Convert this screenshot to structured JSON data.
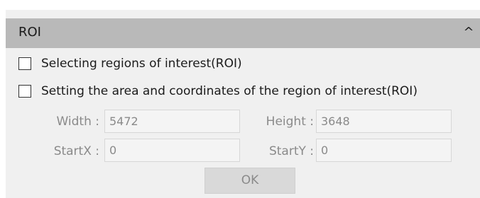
{
  "panel": {
    "title": "ROI",
    "collapse_icon": "chevron-up-icon",
    "collapse_glyph": "^"
  },
  "options": [
    {
      "label": "Selecting regions of interest(ROI)",
      "checked": false
    },
    {
      "label": "Setting the area and coordinates of the region of interest(ROI)",
      "checked": false
    }
  ],
  "fields": {
    "width": {
      "label": "Width :",
      "value": "5472"
    },
    "height": {
      "label": "Height :",
      "value": "3648"
    },
    "start_x": {
      "label": "StartX :",
      "value": "0"
    },
    "start_y": {
      "label": "StartY :",
      "value": "0"
    }
  },
  "ok_button": {
    "label": "OK",
    "enabled": false
  },
  "colors": {
    "panel_bg": "#f0f0f0",
    "header_bg": "#b9b9b9",
    "disabled_text": "#8a8a8a",
    "input_bg": "#f4f4f4",
    "button_bg": "#d9d9d9"
  }
}
